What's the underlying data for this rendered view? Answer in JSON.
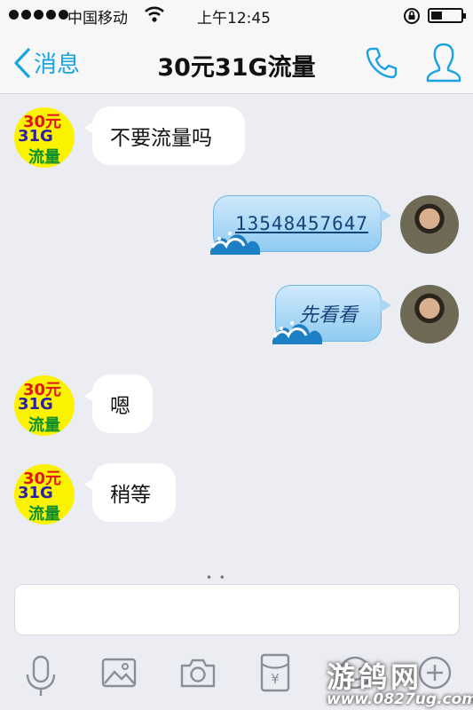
{
  "status_bar": {
    "carrier": "中国移动",
    "time": "上午12:45",
    "icons": [
      "signal-dots",
      "wifi-icon",
      "rotation-lock-icon",
      "battery-icon"
    ]
  },
  "nav": {
    "back_label": "消息",
    "title": "30元31G流量",
    "icons": [
      "chevron-left-icon",
      "phone-icon",
      "profile-icon"
    ]
  },
  "contact_avatar": {
    "line1": "30元",
    "line2": "31G",
    "line3": "流量"
  },
  "messages": [
    {
      "direction": "in",
      "text": "不要流量吗"
    },
    {
      "direction": "out",
      "text": "13548457647"
    },
    {
      "direction": "out",
      "text": "先看看"
    },
    {
      "direction": "in",
      "text": "嗯"
    },
    {
      "direction": "in",
      "text": "稍等"
    }
  ],
  "input": {
    "value": "",
    "placeholder": ""
  },
  "toolbar": {
    "icons": [
      "microphone-icon",
      "image-icon",
      "camera-icon",
      "red-packet-icon",
      "emoji-icon",
      "plus-icon"
    ],
    "red_packet_symbol": "¥"
  },
  "watermark": {
    "logo": "游鸽网",
    "url": "www.0827ug.com"
  },
  "colors": {
    "accent": "#1aa3e2",
    "background": "#ebedf2",
    "bubble_in": "#ffffff",
    "bubble_out": "#a9d6f5"
  }
}
